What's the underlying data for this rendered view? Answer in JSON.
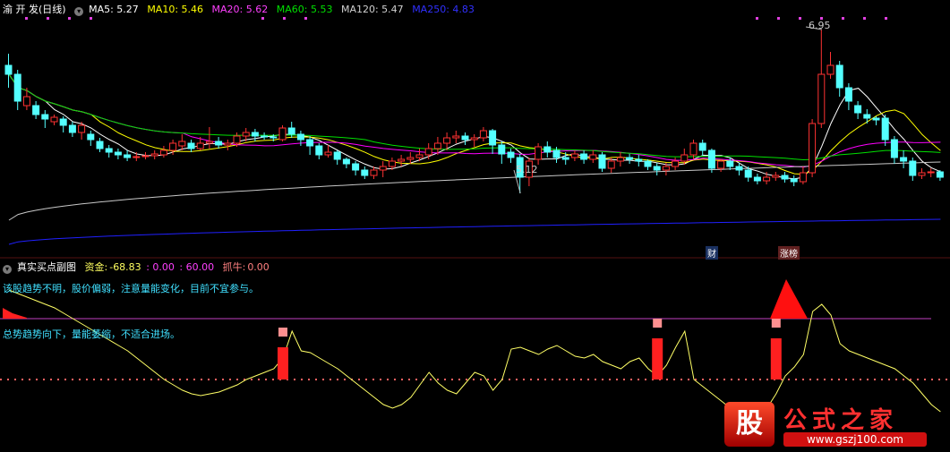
{
  "header": {
    "stock_name": "渝 开 发",
    "period": "(日线)",
    "ma5": "MA5: 5.27",
    "ma10": "MA10: 5.46",
    "ma20": "MA20: 5.62",
    "ma60": "MA60: 5.53",
    "ma120": "MA120: 5.47",
    "ma250": "MA250: 4.83"
  },
  "sub": {
    "title": "真实买点副图",
    "fund_label": "资金:",
    "fund_value": "-68.83",
    "v2": ": 0.00",
    "v3": ": 60.00",
    "catch_label": "抓牛:",
    "catch_value": "0.00",
    "msg1": "该股趋势不明，股价偏弱，注意量能变化，目前不宜参与。",
    "msg2": "总势趋势向下，量能萎缩，不适合进场。"
  },
  "annotations": {
    "high": "6.95",
    "low": "5.12",
    "cai": "财",
    "zhangbang": "涨榜"
  },
  "logo": {
    "text": "公式之家",
    "url": "www.gszj100.com",
    "icon_char": "股"
  },
  "colors": {
    "up": "#ff3232",
    "down": "#54ffff",
    "ma5": "#ffffff",
    "ma10": "#ffff00",
    "ma20": "#ff00ff",
    "ma60": "#00e000",
    "ma120": "#c8c8c8",
    "ma250": "#2020ff",
    "fund": "#ffff66",
    "signal": "#ff2020",
    "baseline": "#c040c0"
  },
  "chart_data": [
    {
      "type": "candlestick",
      "ma_values": {
        "MA5": 5.27,
        "MA10": 5.46,
        "MA20": 5.62,
        "MA60": 5.53,
        "MA120": 5.47,
        "MA250": 4.83
      },
      "marked_high": 6.95,
      "marked_low": 5.12,
      "candles": [
        [
          0,
          6.55,
          6.45,
          6.68,
          6.3
        ],
        [
          1,
          6.45,
          6.15,
          6.5,
          6.05
        ],
        [
          2,
          6.1,
          6.2,
          6.3,
          6.05
        ],
        [
          3,
          6.1,
          6.0,
          6.15,
          5.95
        ],
        [
          4,
          6.0,
          5.95,
          6.05,
          5.85
        ],
        [
          5,
          5.92,
          5.97,
          6.0,
          5.88
        ],
        [
          6,
          5.95,
          5.88,
          5.98,
          5.8
        ],
        [
          7,
          5.88,
          5.8,
          5.92,
          5.75
        ],
        [
          8,
          5.8,
          5.88,
          5.92,
          5.72
        ],
        [
          9,
          5.78,
          5.72,
          5.82,
          5.65
        ],
        [
          10,
          5.7,
          5.62,
          5.74,
          5.58
        ],
        [
          11,
          5.62,
          5.58,
          5.66,
          5.52
        ],
        [
          12,
          5.58,
          5.55,
          5.62,
          5.5
        ],
        [
          13,
          5.55,
          5.52,
          5.6,
          5.48
        ],
        [
          14,
          5.52,
          5.53,
          5.58,
          5.48
        ],
        [
          15,
          5.53,
          5.54,
          5.58,
          5.5
        ],
        [
          16,
          5.54,
          5.56,
          5.6,
          5.5
        ],
        [
          17,
          5.55,
          5.6,
          5.65,
          5.52
        ],
        [
          18,
          5.6,
          5.68,
          5.72,
          5.55
        ],
        [
          19,
          5.65,
          5.7,
          5.78,
          5.6
        ],
        [
          20,
          5.68,
          5.62,
          5.72,
          5.58
        ],
        [
          21,
          5.62,
          5.68,
          5.75,
          5.6
        ],
        [
          22,
          5.68,
          5.7,
          5.86,
          5.62
        ],
        [
          23,
          5.7,
          5.66,
          5.75,
          5.62
        ],
        [
          24,
          5.66,
          5.68,
          5.72,
          5.6
        ],
        [
          25,
          5.68,
          5.76,
          5.8,
          5.64
        ],
        [
          26,
          5.76,
          5.8,
          5.85,
          5.7
        ],
        [
          27,
          5.8,
          5.76,
          5.84,
          5.7
        ],
        [
          28,
          5.76,
          5.75,
          5.8,
          5.72
        ],
        [
          29,
          5.75,
          5.74,
          5.78,
          5.7
        ],
        [
          30,
          5.72,
          5.85,
          5.88,
          5.7
        ],
        [
          31,
          5.85,
          5.78,
          5.92,
          5.74
        ],
        [
          32,
          5.78,
          5.72,
          5.82,
          5.65
        ],
        [
          33,
          5.72,
          5.65,
          5.76,
          5.55
        ],
        [
          34,
          5.65,
          5.55,
          5.68,
          5.5
        ],
        [
          35,
          5.55,
          5.58,
          5.66,
          5.52
        ],
        [
          36,
          5.58,
          5.5,
          5.6,
          5.44
        ],
        [
          37,
          5.5,
          5.45,
          5.52,
          5.4
        ],
        [
          38,
          5.45,
          5.38,
          5.48,
          5.32
        ],
        [
          39,
          5.38,
          5.32,
          5.42,
          5.28
        ],
        [
          40,
          5.32,
          5.38,
          5.42,
          5.28
        ],
        [
          41,
          5.38,
          5.42,
          5.48,
          5.3
        ],
        [
          42,
          5.42,
          5.48,
          5.52,
          5.38
        ],
        [
          43,
          5.48,
          5.5,
          5.55,
          5.42
        ],
        [
          44,
          5.5,
          5.52,
          5.58,
          5.45
        ],
        [
          45,
          5.52,
          5.55,
          5.62,
          5.48
        ],
        [
          46,
          5.55,
          5.62,
          5.68,
          5.5
        ],
        [
          47,
          5.62,
          5.68,
          5.75,
          5.55
        ],
        [
          48,
          5.68,
          5.74,
          5.8,
          5.6
        ],
        [
          49,
          5.74,
          5.76,
          5.82,
          5.68
        ],
        [
          50,
          5.76,
          5.72,
          5.8,
          5.66
        ],
        [
          51,
          5.72,
          5.74,
          5.78,
          5.64
        ],
        [
          52,
          5.74,
          5.82,
          5.86,
          5.7
        ],
        [
          53,
          5.82,
          5.66,
          5.84,
          5.56
        ],
        [
          54,
          5.66,
          5.56,
          5.7,
          5.45
        ],
        [
          55,
          5.58,
          5.52,
          5.62,
          5.46
        ],
        [
          56,
          5.52,
          5.3,
          5.56,
          5.12
        ],
        [
          57,
          5.3,
          5.48,
          5.52,
          5.2
        ],
        [
          58,
          5.5,
          5.64,
          5.68,
          5.44
        ],
        [
          59,
          5.64,
          5.58,
          5.7,
          5.52
        ],
        [
          60,
          5.6,
          5.52,
          5.64,
          5.46
        ],
        [
          61,
          5.52,
          5.5,
          5.58,
          5.44
        ],
        [
          62,
          5.52,
          5.56,
          5.6,
          5.48
        ],
        [
          63,
          5.56,
          5.5,
          5.6,
          5.45
        ],
        [
          64,
          5.5,
          5.55,
          5.6,
          5.46
        ],
        [
          65,
          5.55,
          5.4,
          5.58,
          5.36
        ],
        [
          66,
          5.4,
          5.48,
          5.52,
          5.35
        ],
        [
          67,
          5.48,
          5.52,
          5.58,
          5.42
        ],
        [
          68,
          5.52,
          5.5,
          5.56,
          5.45
        ],
        [
          69,
          5.5,
          5.48,
          5.55,
          5.42
        ],
        [
          70,
          5.48,
          5.42,
          5.5,
          5.38
        ],
        [
          71,
          5.42,
          5.38,
          5.46,
          5.32
        ],
        [
          72,
          5.38,
          5.42,
          5.46,
          5.32
        ],
        [
          73,
          5.42,
          5.48,
          5.52,
          5.38
        ],
        [
          74,
          5.48,
          5.55,
          5.62,
          5.44
        ],
        [
          75,
          5.55,
          5.68,
          5.72,
          5.5
        ],
        [
          76,
          5.68,
          5.6,
          5.72,
          5.54
        ],
        [
          77,
          5.6,
          5.4,
          5.62,
          5.35
        ],
        [
          78,
          5.4,
          5.48,
          5.5,
          5.36
        ],
        [
          79,
          5.48,
          5.42,
          5.52,
          5.38
        ],
        [
          80,
          5.42,
          5.38,
          5.46,
          5.32
        ],
        [
          81,
          5.38,
          5.3,
          5.42,
          5.25
        ],
        [
          82,
          5.3,
          5.26,
          5.34,
          5.22
        ],
        [
          83,
          5.26,
          5.3,
          5.36,
          5.22
        ],
        [
          84,
          5.3,
          5.32,
          5.36,
          5.26
        ],
        [
          85,
          5.32,
          5.28,
          5.36,
          5.24
        ],
        [
          86,
          5.28,
          5.25,
          5.32,
          5.2
        ],
        [
          87,
          5.25,
          5.35,
          5.42,
          5.22
        ],
        [
          88,
          5.35,
          5.9,
          5.95,
          5.3
        ],
        [
          89,
          5.9,
          6.45,
          6.95,
          5.85
        ],
        [
          90,
          6.45,
          6.55,
          6.7,
          6.4
        ],
        [
          91,
          6.55,
          6.3,
          6.6,
          6.2
        ],
        [
          92,
          6.3,
          6.15,
          6.35,
          6.05
        ],
        [
          93,
          6.1,
          6.02,
          6.15,
          5.95
        ],
        [
          94,
          6.0,
          5.96,
          6.06,
          5.9
        ],
        [
          95,
          5.96,
          5.94,
          5.98,
          5.88
        ],
        [
          96,
          5.96,
          5.72,
          6.0,
          5.65
        ],
        [
          97,
          5.72,
          5.52,
          5.76,
          5.45
        ],
        [
          98,
          5.52,
          5.48,
          5.6,
          5.4
        ],
        [
          99,
          5.48,
          5.32,
          5.52,
          5.26
        ],
        [
          100,
          5.32,
          5.35,
          5.4,
          5.28
        ],
        [
          101,
          5.35,
          5.36,
          5.4,
          5.3
        ],
        [
          102,
          5.36,
          5.3,
          5.38,
          5.26
        ]
      ]
    },
    {
      "type": "line",
      "series": [
        {
          "name": "资金",
          "values": [
            28,
            26,
            24,
            22,
            20,
            18,
            15,
            12,
            9,
            6,
            3,
            0,
            -3,
            -6,
            -10,
            -14,
            -18,
            -22,
            -25,
            -28,
            -30,
            -31,
            -30,
            -29,
            -27,
            -25,
            -22,
            -20,
            -18,
            -16,
            -10,
            5,
            -6,
            -7,
            -10,
            -13,
            -16,
            -20,
            -24,
            -28,
            -32,
            -36,
            -38,
            -36,
            -32,
            -25,
            -18,
            -24,
            -28,
            -30,
            -24,
            -18,
            -20,
            -28,
            -22,
            -5,
            -4,
            -6,
            -8,
            -5,
            -3,
            -6,
            -9,
            -10,
            -8,
            -12,
            -14,
            -16,
            -12,
            -10,
            -16,
            -20,
            -14,
            -4,
            5,
            -22,
            -26,
            -30,
            -34,
            -38,
            -42,
            -46,
            -44,
            -38,
            -30,
            -20,
            -15,
            -8,
            16,
            20,
            14,
            -2,
            -6,
            -8,
            -10,
            -12,
            -14,
            -16,
            -20,
            -24,
            -30,
            -36,
            -40
          ]
        }
      ]
    }
  ]
}
